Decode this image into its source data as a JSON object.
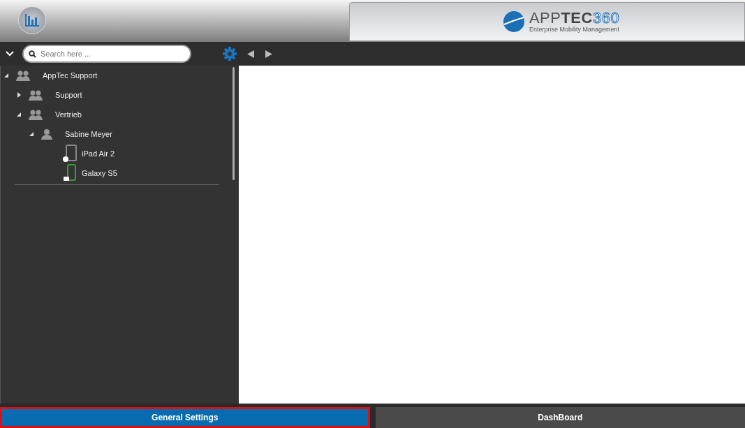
{
  "logo": {
    "name_light": "APP",
    "name_bold": "TEC",
    "name_number": "360",
    "tagline": "Enterprise Mobility Management"
  },
  "search": {
    "placeholder": "Search here ..."
  },
  "tree": [
    {
      "kind": "group",
      "label": "AppTec Support",
      "expanded": true,
      "children": [
        {
          "kind": "group",
          "label": "Support",
          "expanded": false
        },
        {
          "kind": "group",
          "label": "Vertrieb",
          "expanded": true,
          "children": [
            {
              "kind": "user",
              "label": "Sabine Meyer",
              "expanded": true,
              "children": [
                {
                  "kind": "ios-tablet",
                  "label": "iPad Air 2"
                },
                {
                  "kind": "android-phone",
                  "label": "Galaxy S5"
                }
              ]
            }
          ]
        }
      ]
    }
  ],
  "bottom_tabs": [
    {
      "label": "General Settings",
      "selected": true
    },
    {
      "label": "DashBoard",
      "selected": false
    }
  ]
}
